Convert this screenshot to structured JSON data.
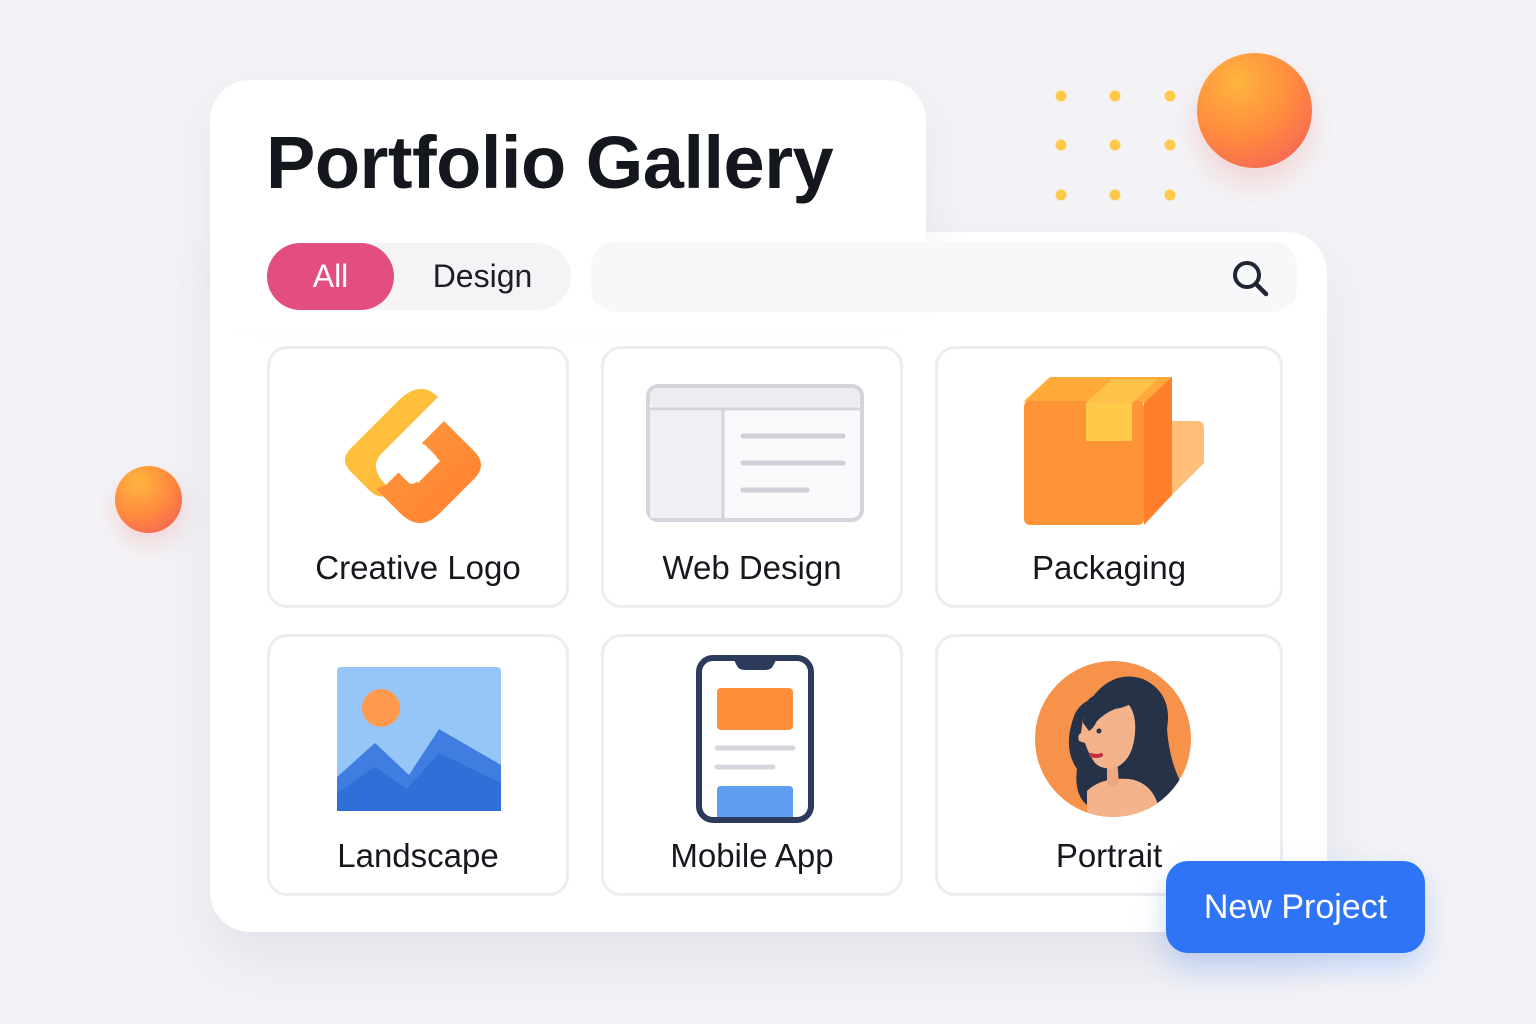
{
  "header": {
    "title": "Portfolio Gallery"
  },
  "filters": [
    {
      "label": "All",
      "active": true
    },
    {
      "label": "Design",
      "active": false
    }
  ],
  "search": {
    "value": "",
    "placeholder": "",
    "icon": "search-icon"
  },
  "projects": [
    {
      "label": "Creative Logo",
      "icon": "logo-icon"
    },
    {
      "label": "Web Design",
      "icon": "browser-window-icon"
    },
    {
      "label": "Packaging",
      "icon": "box-icon"
    },
    {
      "label": "Landscape",
      "icon": "landscape-image-icon"
    },
    {
      "label": "Mobile App",
      "icon": "smartphone-icon"
    },
    {
      "label": "Portrait",
      "icon": "portrait-avatar-icon"
    }
  ],
  "actions": {
    "new_project_label": "New Project"
  },
  "colors": {
    "background": "#f3f3f7",
    "active_filter": "#e24d82",
    "primary_button": "#2f73f6",
    "accent_orange": "#ff8a3f",
    "accent_yellow": "#ffc94a"
  }
}
